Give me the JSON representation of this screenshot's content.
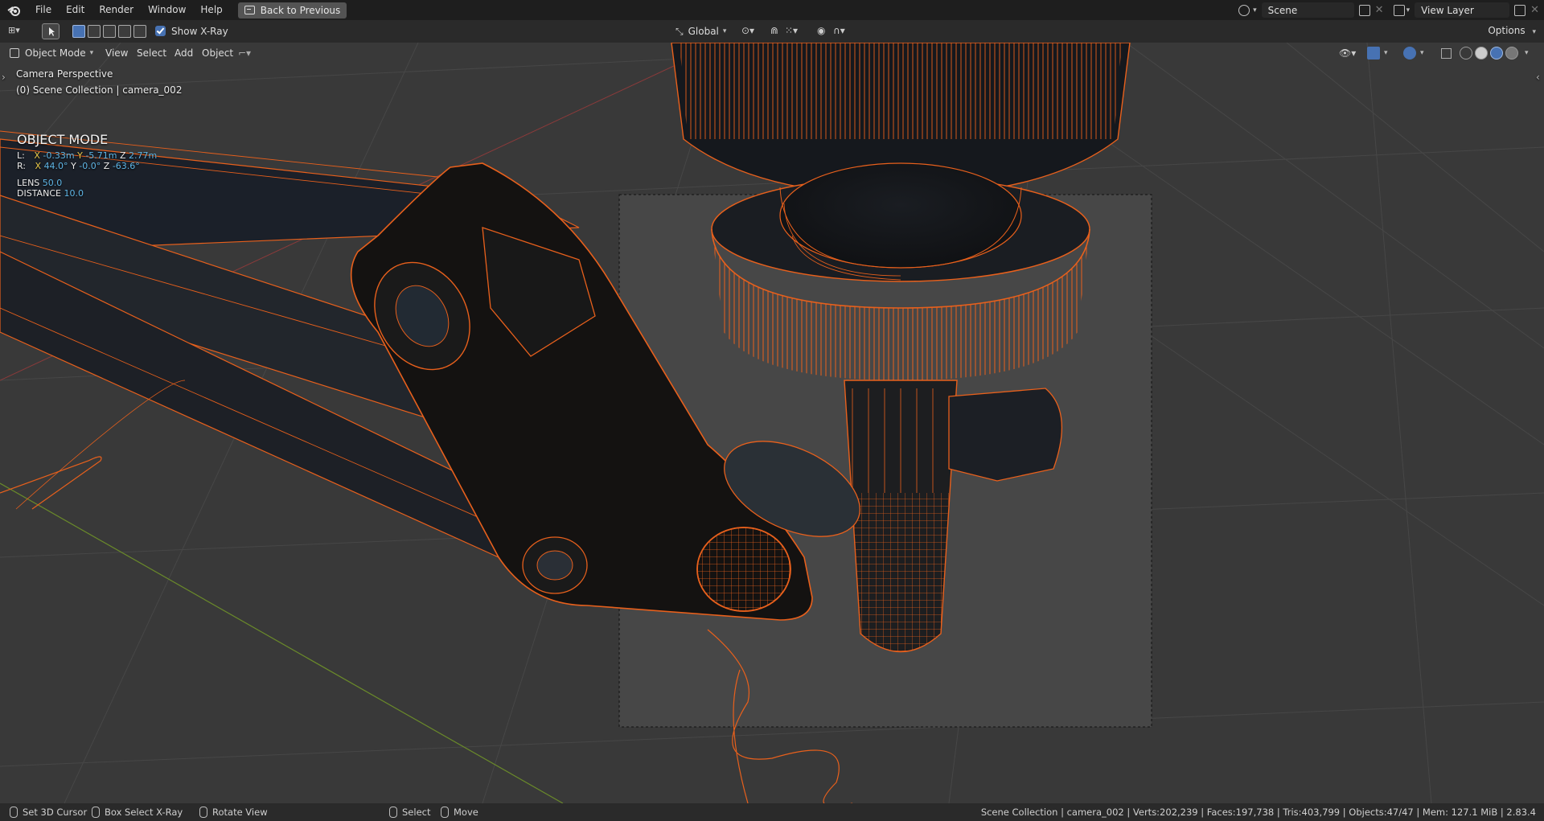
{
  "menubar": {
    "items": [
      "File",
      "Edit",
      "Render",
      "Window",
      "Help"
    ],
    "back_button": "Back to Previous",
    "scene": "Scene",
    "view_layer": "View Layer"
  },
  "toolheader": {
    "show_xray_label": "Show X-Ray",
    "transform_orientation": "Global",
    "options_label": "Options"
  },
  "viewheader": {
    "mode": "Object Mode",
    "menus": [
      "View",
      "Select",
      "Add",
      "Object"
    ]
  },
  "overlay": {
    "perspective": "Camera Perspective",
    "collection": "(0) Scene Collection | camera_002",
    "mode_title": "OBJECT MODE",
    "loc_label": "L:",
    "loc": {
      "x_label": "X",
      "x": "-0.33m",
      "y_label": "Y",
      "y": "-5.71m",
      "z_label": "Z",
      "z": "2.77m"
    },
    "rot_label": "R:",
    "rot": {
      "x_label": "X",
      "x": "44.0°",
      "y_label": "Y",
      "y": "-0.0°",
      "z_label": "Z",
      "z": "-63.6°"
    },
    "lens_label": "LENS",
    "lens": "50.0",
    "distance_label": "DISTANCE",
    "distance": "10.0"
  },
  "statusbar": {
    "set_cursor": "Set 3D Cursor",
    "box_select": "Box Select X-Ray",
    "rotate_view": "Rotate View",
    "select": "Select",
    "move": "Move",
    "stats": "Scene Collection | camera_002 | Verts:202,239 | Faces:197,738 | Tris:403,799 | Objects:47/47 | Mem: 127.1 MiB | 2.83.4"
  },
  "colors": {
    "wire": "#e8601c",
    "accent": "#4772b3",
    "info_blue": "#5fb6e6"
  }
}
